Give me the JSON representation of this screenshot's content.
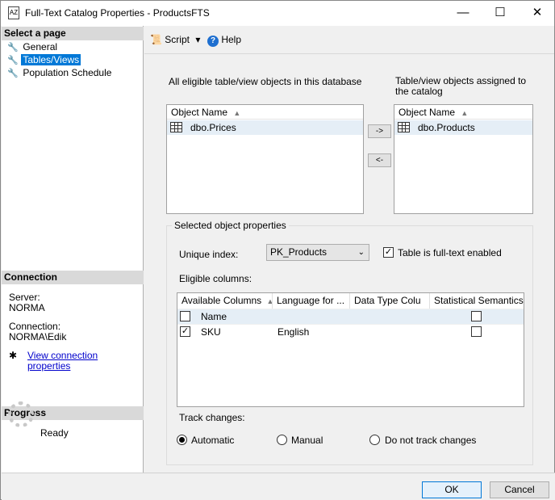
{
  "window": {
    "title": "Full-Text Catalog Properties - ProductsFTS",
    "minimize_glyph": "—",
    "maximize_glyph": "☐",
    "close_glyph": "✕"
  },
  "left": {
    "select_page_header": "Select a page",
    "pages": [
      {
        "label": "General",
        "icon": "wrench-icon"
      },
      {
        "label": "Tables/Views",
        "icon": "wrench-icon",
        "selected": true
      },
      {
        "label": "Population Schedule",
        "icon": "wrench-icon"
      }
    ],
    "connection_header": "Connection",
    "server_label": "Server:",
    "server_value": "NORMA",
    "connection_label": "Connection:",
    "connection_value": "NORMA\\Edik",
    "view_connection_link": "View connection properties",
    "progress_header": "Progress",
    "progress_status": "Ready"
  },
  "toolbar": {
    "script_label": "Script",
    "help_label": "Help"
  },
  "main": {
    "eligible_label": "All eligible table/view objects in this database",
    "assigned_label": "Table/view objects assigned to the catalog",
    "eligible_header": "Object Name",
    "eligible_items": [
      "dbo.Prices"
    ],
    "assigned_header": "Object Name",
    "assigned_items": [
      "dbo.Products"
    ],
    "move_right_label": "->",
    "move_left_label": "<-",
    "props_group_title": "Selected object properties",
    "unique_index_label": "Unique index:",
    "unique_index_value": "PK_Products",
    "fulltext_enabled_label": "Table is full-text enabled",
    "fulltext_enabled_checked": true,
    "eligible_columns_label": "Eligible columns:",
    "grid_headers": [
      "Available Columns",
      "Language for ...",
      "Data Type Colu",
      "Statistical Semantics"
    ],
    "grid_rows": [
      {
        "checked": false,
        "name": "Name",
        "language": "",
        "datatype": "",
        "semantics": false
      },
      {
        "checked": true,
        "name": "SKU",
        "language": "English",
        "datatype": "",
        "semantics": false
      }
    ],
    "track_changes_label": "Track changes:",
    "track_options": [
      "Automatic",
      "Manual",
      "Do not track changes"
    ],
    "track_selected": "Automatic"
  },
  "footer": {
    "ok_label": "OK",
    "cancel_label": "Cancel"
  },
  "colors": {
    "accent": "#0078d7",
    "link": "#0000cc",
    "header_bg": "#d9d9d9"
  }
}
